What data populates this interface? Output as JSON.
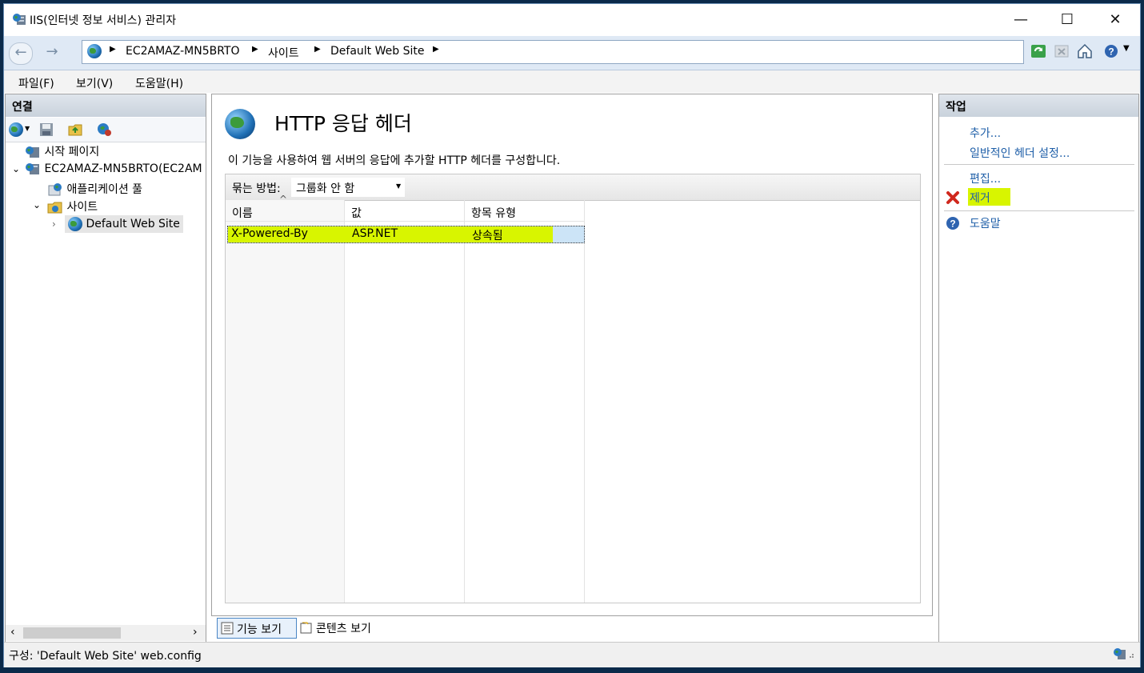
{
  "window": {
    "title": "IIS(인터넷 정보 서비스) 관리자",
    "minimize": "—",
    "maximize": "☐",
    "close": "✕"
  },
  "nav": {
    "back": "←",
    "forward": "→",
    "breadcrumbs": [
      "EC2AMAZ-MN5BRTO",
      "사이트",
      "Default Web Site"
    ],
    "sep": "▶"
  },
  "menu": {
    "file": "파일(F)",
    "view": "보기(V)",
    "help": "도움말(H)"
  },
  "connections": {
    "header": "연결",
    "tree": {
      "start_page": "시작 페이지",
      "server": "EC2AMAZ-MN5BRTO(EC2AM",
      "app_pools": "애플리케이션 풀",
      "sites": "사이트",
      "default_site": "Default Web Site"
    }
  },
  "main": {
    "title": "HTTP 응답 헤더",
    "description": "이 기능을 사용하여 웹 서버의 응답에 추가할 HTTP 헤더를 구성합니다.",
    "group_by_label": "묶는 방법:",
    "group_by_value": "그룹화 안 함",
    "columns": [
      "이름",
      "값",
      "항목 유형"
    ],
    "rows": [
      {
        "name": "X-Powered-By",
        "value": "ASP.NET",
        "type": "상속됨"
      }
    ],
    "views": {
      "features": "기능 보기",
      "content": "콘텐츠 보기"
    }
  },
  "actions": {
    "header": "작업",
    "add": "추가...",
    "common_headers": "일반적인 헤더 설정...",
    "edit": "편집...",
    "remove": "제거",
    "help": "도움말"
  },
  "status": {
    "text": "구성: 'Default Web Site' web.config"
  },
  "colors": {
    "highlight": "#d8f500",
    "link": "#1f5fa8",
    "selection": "#cce4f7"
  }
}
